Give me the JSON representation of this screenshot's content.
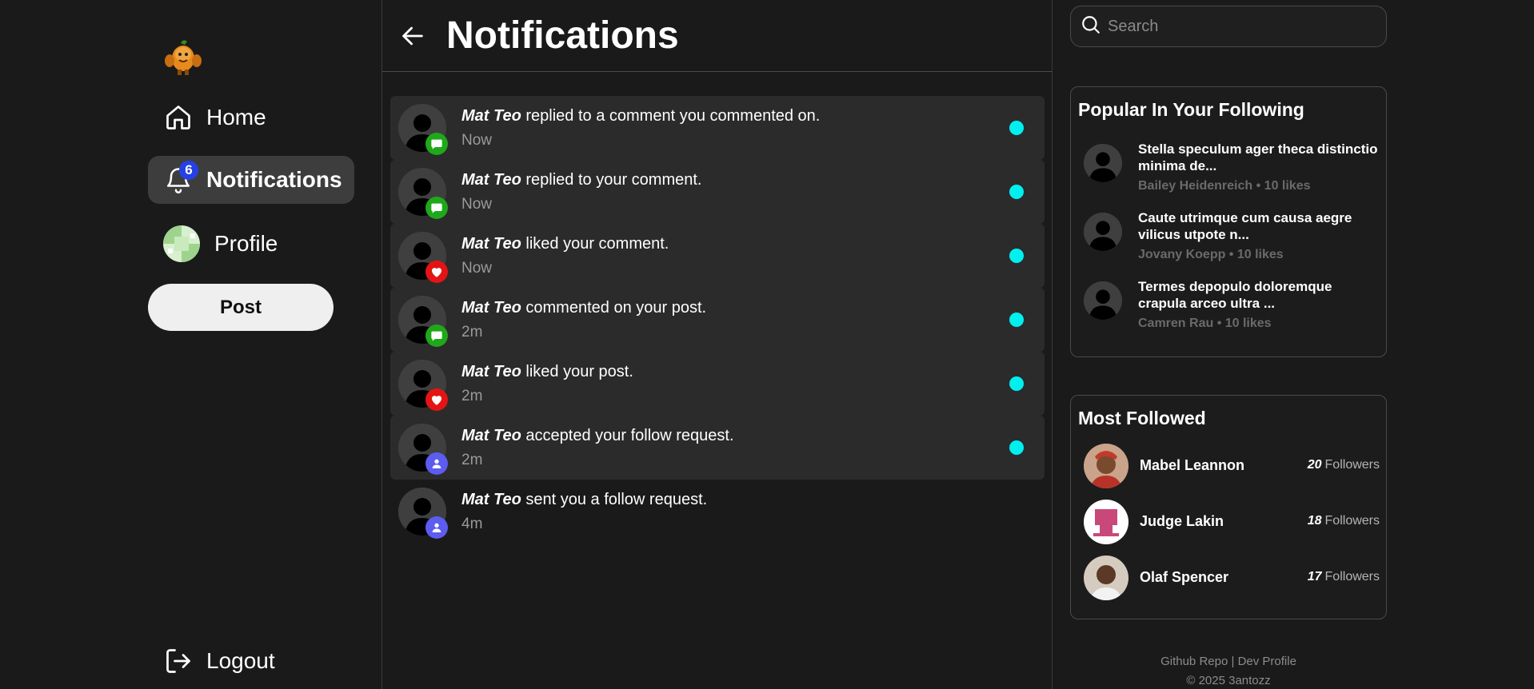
{
  "nav": {
    "logo_icon": "muscle-mango-logo",
    "home_label": "Home",
    "notifications_label": "Notifications",
    "notifications_count": "6",
    "profile_label": "Profile",
    "post_label": "Post",
    "logout_label": "Logout"
  },
  "main": {
    "title": "Notifications",
    "back_icon": "arrow-left-icon",
    "notifications": [
      {
        "user": "Mat Teo",
        "text": "replied to a comment you commented on.",
        "time": "Now",
        "type": "comment",
        "unread": true
      },
      {
        "user": "Mat Teo",
        "text": "replied to your comment.",
        "time": "Now",
        "type": "comment",
        "unread": true
      },
      {
        "user": "Mat Teo",
        "text": "liked your comment.",
        "time": "Now",
        "type": "like",
        "unread": true
      },
      {
        "user": "Mat Teo",
        "text": "commented on your post.",
        "time": "2m",
        "type": "comment",
        "unread": true
      },
      {
        "user": "Mat Teo",
        "text": "liked your post.",
        "time": "2m",
        "type": "like",
        "unread": true
      },
      {
        "user": "Mat Teo",
        "text": "accepted your follow request.",
        "time": "2m",
        "type": "follow",
        "unread": true
      },
      {
        "user": "Mat Teo",
        "text": "sent you a follow request.",
        "time": "4m",
        "type": "follow",
        "unread": false
      }
    ]
  },
  "search": {
    "placeholder": "Search"
  },
  "popular": {
    "title": "Popular In Your Following",
    "items": [
      {
        "title": "Stella speculum ager theca distinctio minima de...",
        "meta": "Bailey Heidenreich • 10 likes"
      },
      {
        "title": "Caute utrimque cum causa aegre vilicus utpote n...",
        "meta": "Jovany Koepp • 10 likes"
      },
      {
        "title": "Termes depopulo doloremque crapula arceo ultra ...",
        "meta": "Camren Rau • 10 likes"
      }
    ]
  },
  "followed": {
    "title": "Most Followed",
    "followers_label": "Followers",
    "items": [
      {
        "name": "Mabel Leannon",
        "count": "20"
      },
      {
        "name": "Judge Lakin",
        "count": "18"
      },
      {
        "name": "Olaf Spencer",
        "count": "17"
      }
    ]
  },
  "footer": {
    "github": "Github Repo",
    "separator": "|",
    "dev": "Dev Profile",
    "copyright": "© 2025 3antozz"
  },
  "colors": {
    "background": "#1a1a1a",
    "unread_dot": "#00f0f0",
    "comment_badge": "#1fa81a",
    "like_badge": "#e41414",
    "follow_badge": "#5c5cf0",
    "notif_count_badge": "#2541e6"
  }
}
